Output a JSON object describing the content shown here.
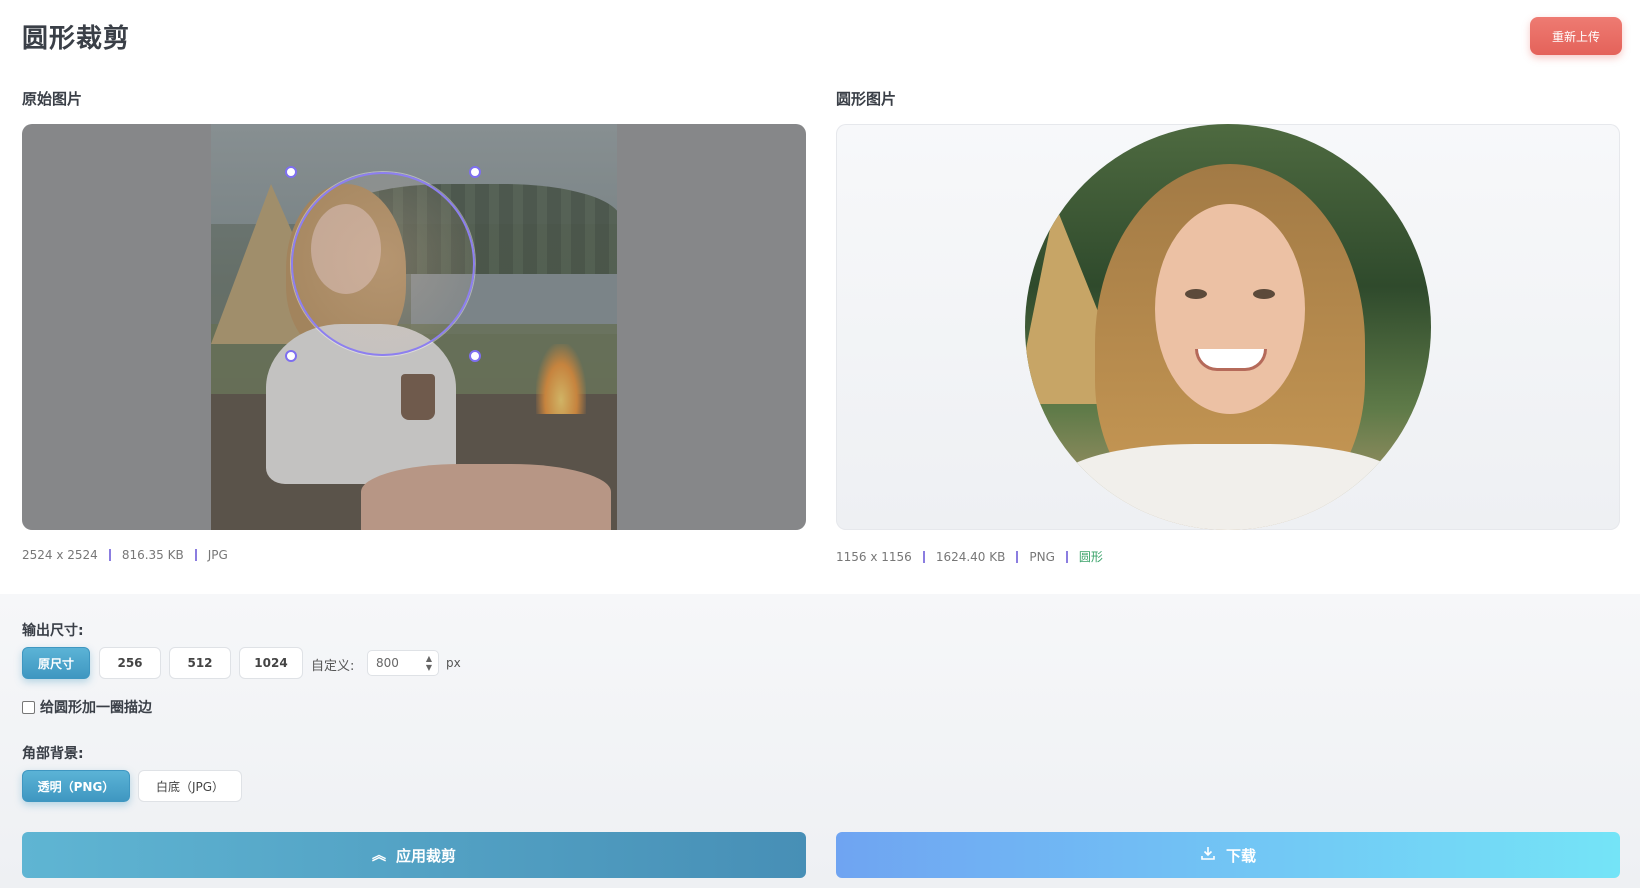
{
  "header": {
    "title": "圆形裁剪",
    "reupload_label": "重新上传"
  },
  "original": {
    "label": "原始图片",
    "dimensions": "2524 x 2524",
    "size": "816.35 KB",
    "format": "JPG"
  },
  "result": {
    "label": "圆形图片",
    "dimensions": "1156 x 1156",
    "size": "1624.40 KB",
    "format": "PNG",
    "shape": "圆形"
  },
  "output_size": {
    "label": "输出尺寸:",
    "options": [
      "原尺寸",
      "256",
      "512",
      "1024"
    ],
    "selected": "原尺寸",
    "custom_label": "自定义:",
    "custom_value": "800",
    "unit": "px"
  },
  "stroke": {
    "label": "给圆形加一圈描边",
    "checked": false
  },
  "corner_bg": {
    "label": "角部背景:",
    "options": [
      "透明（PNG）",
      "白底（JPG）"
    ],
    "selected": "透明（PNG）"
  },
  "actions": {
    "apply_label": "应用裁剪",
    "download_label": "下载"
  },
  "colors": {
    "accent": "#478fb6",
    "reupload": "#e4625a",
    "crop_stroke": "#8d7ff0",
    "shape_text": "#3ba36a"
  }
}
